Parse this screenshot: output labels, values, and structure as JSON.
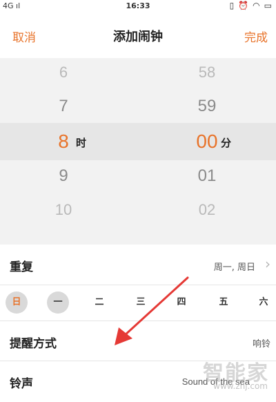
{
  "status_bar": {
    "signal": "4G ıl",
    "time": "16:33",
    "icons": [
      "vibrate-icon",
      "alarm-icon",
      "wifi-icon",
      "battery-icon"
    ]
  },
  "nav": {
    "cancel": "取消",
    "title": "添加闹钟",
    "done": "完成"
  },
  "picker": {
    "hours": [
      "6",
      "7",
      "8",
      "9",
      "10"
    ],
    "minutes": [
      "58",
      "59",
      "00",
      "01",
      "02"
    ],
    "hour_unit": "时",
    "minute_unit": "分"
  },
  "repeat": {
    "label": "重复",
    "value": "周一, 周日",
    "days": [
      "日",
      "一",
      "二",
      "三",
      "四",
      "五",
      "六"
    ]
  },
  "reminder": {
    "label": "提醒方式",
    "value": "响铃"
  },
  "ringtone": {
    "label": "铃声",
    "value": "Sound of the sea"
  },
  "watermark": {
    "text": "智能家",
    "sub": "www.znj.com"
  },
  "colors": {
    "accent": "#e8732a",
    "arrow": "#e53935"
  }
}
